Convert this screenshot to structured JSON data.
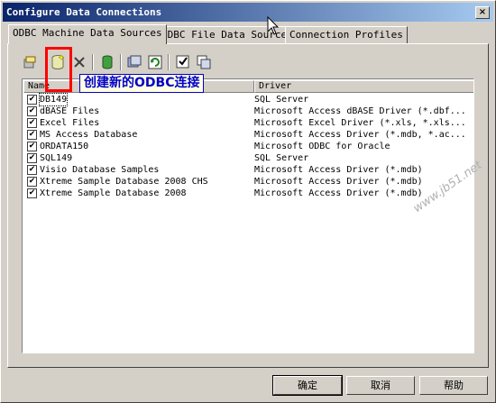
{
  "window": {
    "title": "Configure Data Connections",
    "close_glyph": "×"
  },
  "tabs": [
    {
      "label": "ODBC Machine Data Sources",
      "active": true
    },
    {
      "label": "ODBC File Data Sources",
      "active": false
    },
    {
      "label": "Connection Profiles",
      "active": false
    }
  ],
  "toolbar": {
    "icons": [
      "configure-icon",
      "new-odbc-icon",
      "delete-icon",
      "test-connection-icon",
      "odbc-admin-icon",
      "refresh-icon",
      "select-all-icon",
      "copy-icon"
    ]
  },
  "tooltip": {
    "text": "创建新的ODBC连接"
  },
  "list": {
    "columns": [
      "Name",
      "Driver"
    ],
    "rows": [
      {
        "checked": true,
        "name": "DB149",
        "driver": "SQL Server"
      },
      {
        "checked": true,
        "name": "dBASE Files",
        "driver": "Microsoft Access dBASE Driver (*.dbf..."
      },
      {
        "checked": true,
        "name": "Excel Files",
        "driver": "Microsoft Excel Driver (*.xls, *.xls..."
      },
      {
        "checked": true,
        "name": "MS Access Database",
        "driver": "Microsoft Access Driver (*.mdb, *.ac..."
      },
      {
        "checked": true,
        "name": "ORDATA150",
        "driver": "Microsoft ODBC for Oracle"
      },
      {
        "checked": true,
        "name": "SQL149",
        "driver": "SQL Server"
      },
      {
        "checked": true,
        "name": "Visio Database Samples",
        "driver": "Microsoft Access Driver (*.mdb)"
      },
      {
        "checked": true,
        "name": "Xtreme Sample Database 2008 CHS",
        "driver": "Microsoft Access Driver (*.mdb)"
      },
      {
        "checked": true,
        "name": "Xtreme Sample Database 2008",
        "driver": "Microsoft Access Driver (*.mdb)"
      }
    ]
  },
  "buttons": {
    "ok": "确定",
    "cancel": "取消",
    "help": "帮助"
  },
  "watermark": "www.jb51.net",
  "colors": {
    "highlight": "#ff0000",
    "tooltip_text": "#0000cc",
    "title_bar": "#0a246a"
  }
}
